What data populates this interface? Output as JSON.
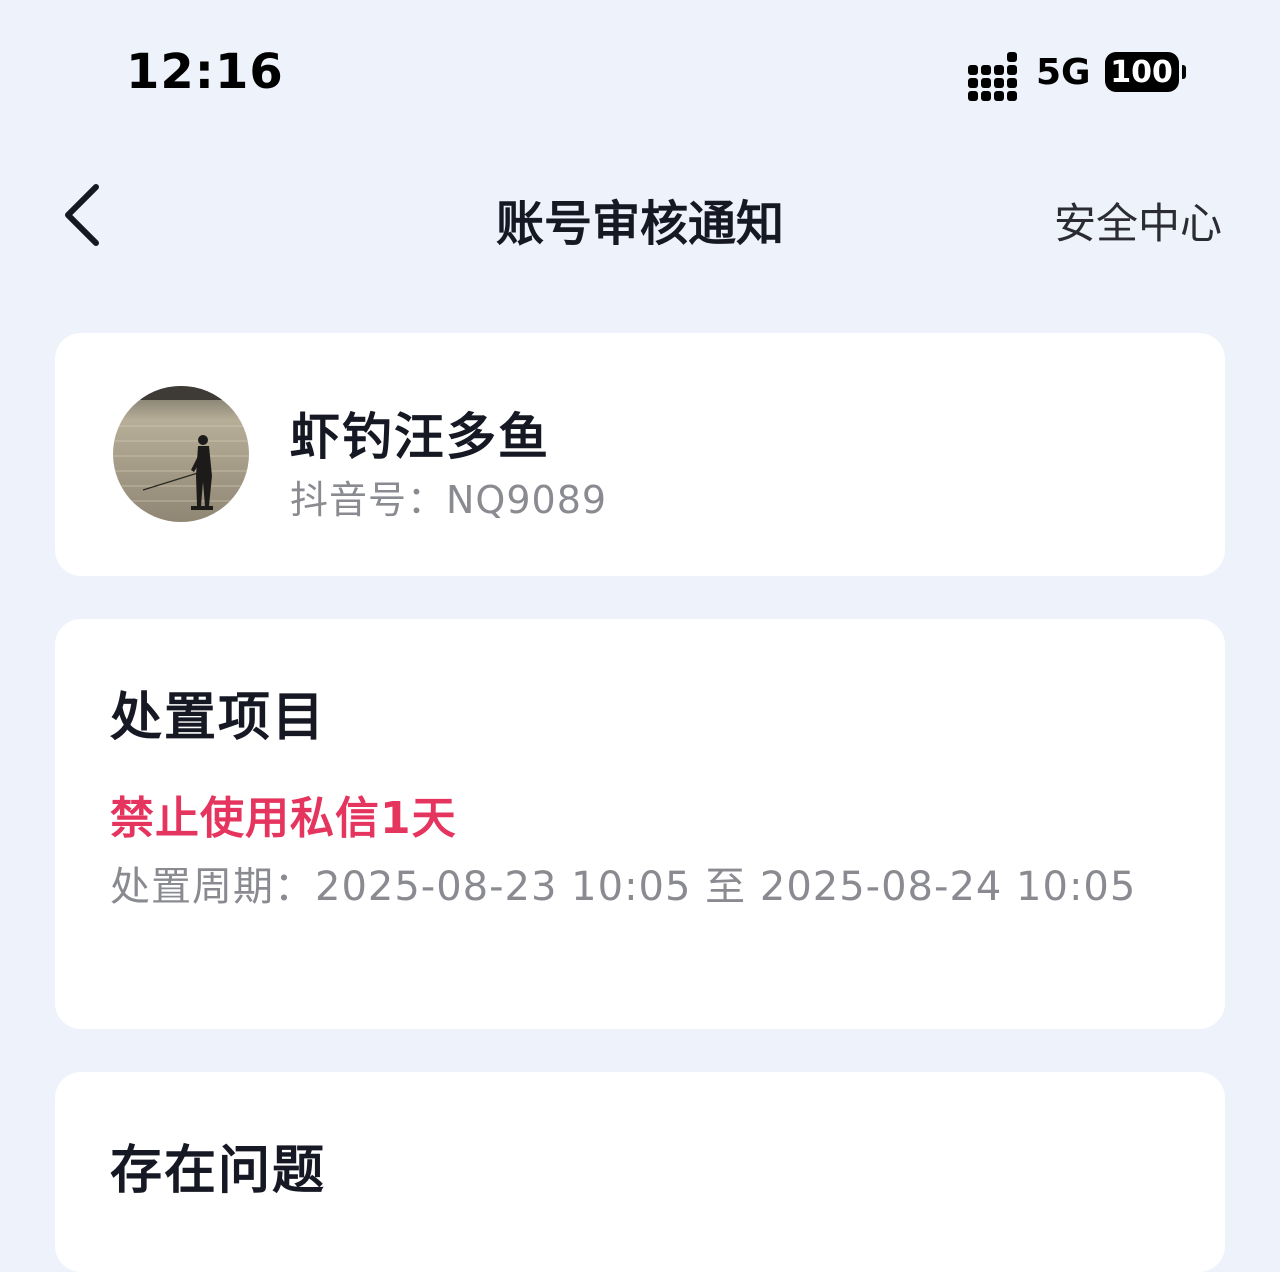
{
  "status_bar": {
    "time": "12:16",
    "network": "5G",
    "battery": "100"
  },
  "nav": {
    "title": "账号审核通知",
    "right_link": "安全中心"
  },
  "user": {
    "name": "虾钓汪多鱼",
    "douyin_id": "抖音号：NQ9089"
  },
  "action": {
    "section_title": "处置项目",
    "item": "禁止使用私信1天",
    "period": "处置周期：2025-08-23 10:05 至 2025-08-24 10:05"
  },
  "issue": {
    "section_title": "存在问题"
  },
  "colors": {
    "background": "#eef2fb",
    "card": "#ffffff",
    "accent_red": "#e5355f",
    "secondary_text": "#8a8b91"
  }
}
